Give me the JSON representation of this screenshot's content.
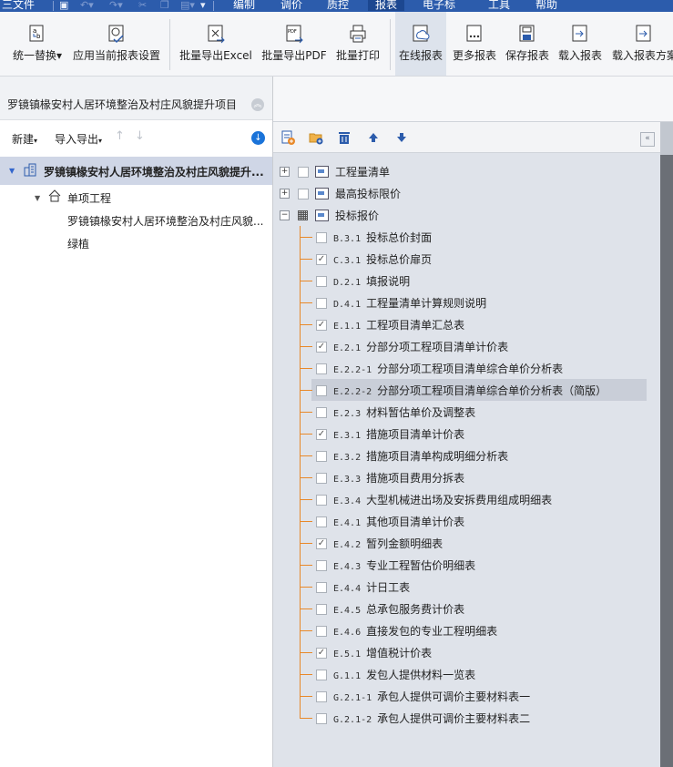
{
  "menubar": {
    "file_label": "三文件",
    "items": [
      "编制",
      "调价",
      "质控",
      "报表",
      "电子标",
      "工具",
      "帮助"
    ],
    "active_index": 3
  },
  "ribbon": {
    "buttons": [
      {
        "label": "统一替换",
        "icon": "replace-icon",
        "dropdown": true
      },
      {
        "label": "应用当前报表设置",
        "icon": "apply-settings-icon"
      },
      {
        "label": "批量导出Excel",
        "icon": "export-excel-icon"
      },
      {
        "label": "批量导出PDF",
        "icon": "export-pdf-icon"
      },
      {
        "label": "批量打印",
        "icon": "print-icon"
      },
      {
        "label": "在线报表",
        "icon": "online-report-icon"
      },
      {
        "label": "更多报表",
        "icon": "more-reports-icon"
      },
      {
        "label": "保存报表",
        "icon": "save-report-icon"
      },
      {
        "label": "载入报表",
        "icon": "load-report-icon"
      },
      {
        "label": "载入报表方案",
        "icon": "load-scheme-icon"
      }
    ]
  },
  "left": {
    "project_title": "罗镜镇椽安村人居环境整治及村庄风貌提升项目",
    "toolbar": {
      "new_label": "新建",
      "import_export_label": "导入导出"
    },
    "tree": {
      "root": "罗镜镇椽安村人居环境整治及村庄风貌提升...",
      "unit": "单项工程",
      "children": [
        "罗镜镇椽安村人居环境整治及村庄风貌...",
        "绿植"
      ]
    }
  },
  "right": {
    "groups": [
      {
        "label": "工程量清单",
        "expanded": false
      },
      {
        "label": "最高投标限价",
        "expanded": false
      },
      {
        "label": "投标报价",
        "expanded": true
      }
    ],
    "reports": [
      {
        "code": "B.3.1",
        "name": "投标总价封面",
        "checked": false
      },
      {
        "code": "C.3.1",
        "name": "投标总价扉页",
        "checked": true
      },
      {
        "code": "D.2.1",
        "name": "填报说明",
        "checked": false
      },
      {
        "code": "D.4.1",
        "name": "工程量清单计算规则说明",
        "checked": false
      },
      {
        "code": "E.1.1",
        "name": "工程项目清单汇总表",
        "checked": true
      },
      {
        "code": "E.2.1",
        "name": "分部分项工程项目清单计价表",
        "checked": true
      },
      {
        "code": "E.2.2-1",
        "name": "分部分项工程项目清单综合单价分析表",
        "checked": false
      },
      {
        "code": "E.2.2-2",
        "name": "分部分项工程项目清单综合单价分析表（简版）",
        "checked": false,
        "selected": true
      },
      {
        "code": "E.2.3",
        "name": "材料暂估单价及调整表",
        "checked": false
      },
      {
        "code": "E.3.1",
        "name": "措施项目清单计价表",
        "checked": true
      },
      {
        "code": "E.3.2",
        "name": "措施项目清单构成明细分析表",
        "checked": false
      },
      {
        "code": "E.3.3",
        "name": "措施项目费用分拆表",
        "checked": false
      },
      {
        "code": "E.3.4",
        "name": "大型机械进出场及安拆费用组成明细表",
        "checked": false
      },
      {
        "code": "E.4.1",
        "name": "其他项目清单计价表",
        "checked": false
      },
      {
        "code": "E.4.2",
        "name": "暂列金额明细表",
        "checked": true
      },
      {
        "code": "E.4.3",
        "name": "专业工程暂估价明细表",
        "checked": false
      },
      {
        "code": "E.4.4",
        "name": "计日工表",
        "checked": false
      },
      {
        "code": "E.4.5",
        "name": "总承包服务费计价表",
        "checked": false
      },
      {
        "code": "E.4.6",
        "name": "直接发包的专业工程明细表",
        "checked": false
      },
      {
        "code": "E.5.1",
        "name": "增值税计价表",
        "checked": true
      },
      {
        "code": "G.1.1",
        "name": "发包人提供材料一览表",
        "checked": false
      },
      {
        "code": "G.2.1-1",
        "name": "承包人提供可调价主要材料表一",
        "checked": false
      },
      {
        "code": "G.2.1-2",
        "name": "承包人提供可调价主要材料表二",
        "checked": false
      }
    ]
  },
  "colors": {
    "accent": "#2c5cac",
    "tree_line": "#e8892a",
    "selection": "#cfd6e6"
  }
}
